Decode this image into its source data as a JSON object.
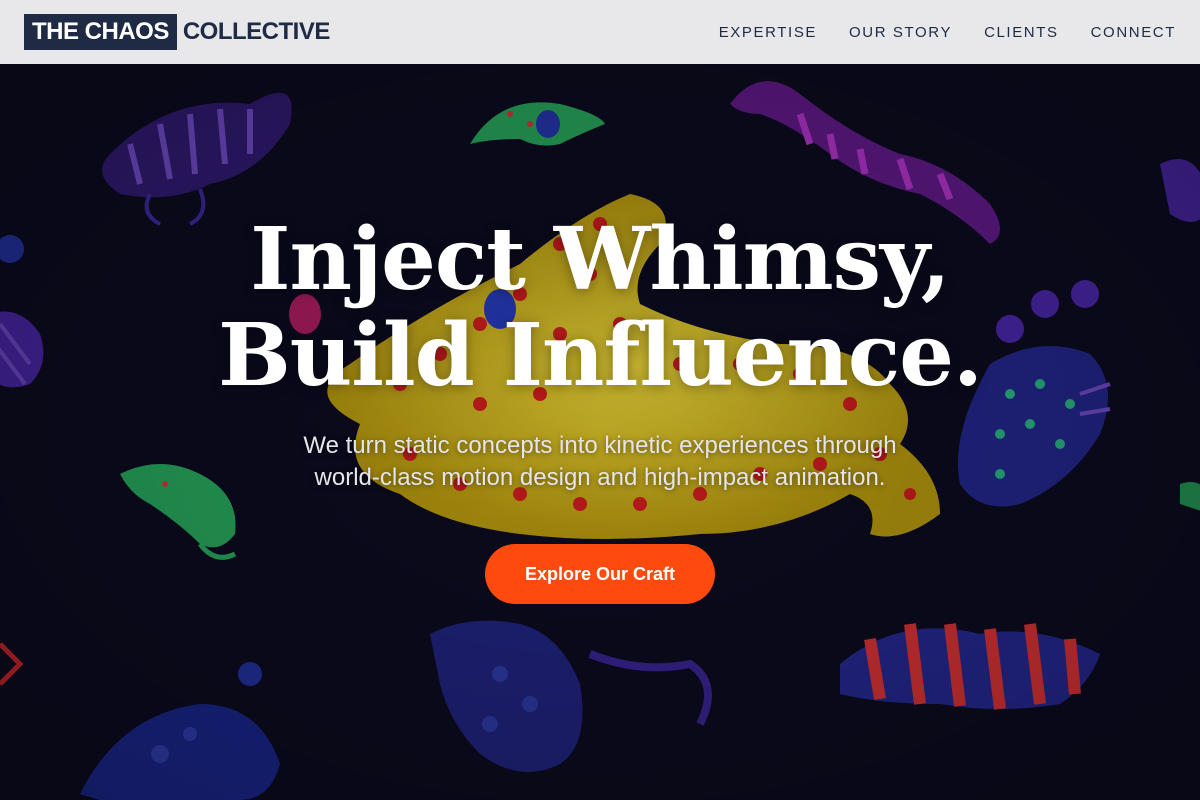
{
  "brand": {
    "logo_box": "THE CHAOS",
    "logo_rest": "COLLECTIVE"
  },
  "nav": [
    {
      "label": "EXPERTISE"
    },
    {
      "label": "OUR STORY"
    },
    {
      "label": "CLIENTS"
    },
    {
      "label": "CONNECT"
    }
  ],
  "hero": {
    "headline_line1": "Inject Whimsy,",
    "headline_line2": "Build Influence.",
    "subtitle_line1": "We turn static concepts into kinetic experiences through",
    "subtitle_line2": "world-class motion design and high-impact animation.",
    "cta_label": "Explore Our Craft",
    "background_image": "neon-creatures-illustration"
  },
  "colors": {
    "nav_bg": "#e8e8eb",
    "brand_dark": "#1f2a44",
    "cta": "#ff4a0f",
    "hero_bg": "#0d0c22"
  }
}
